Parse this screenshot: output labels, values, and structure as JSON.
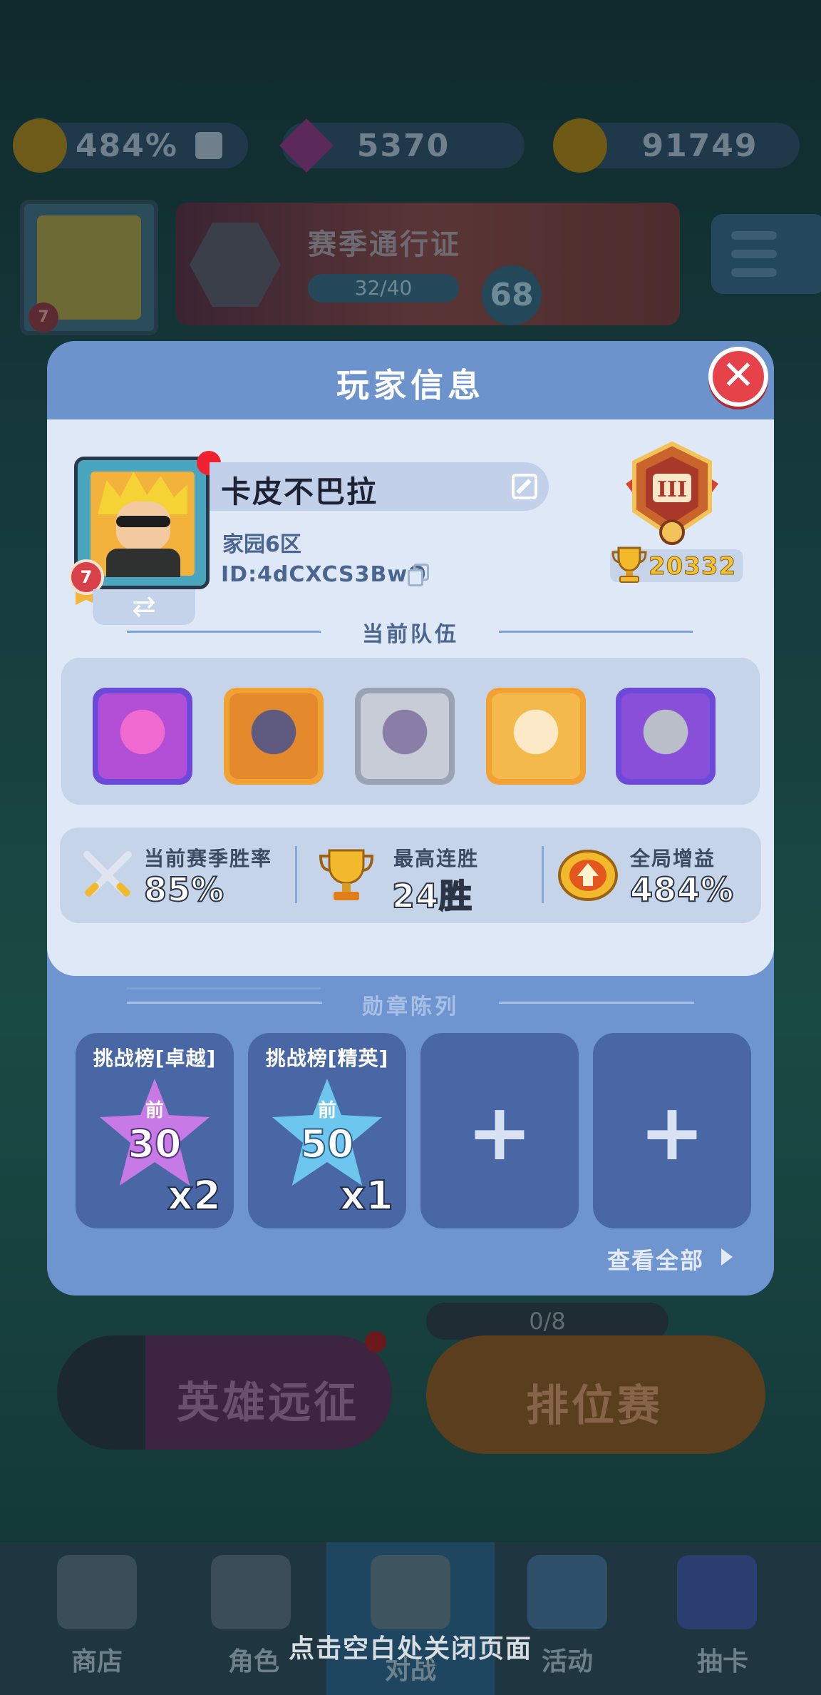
{
  "resources": {
    "global_bonus": "484%",
    "gems": "5370",
    "coins": "91749"
  },
  "background": {
    "player_level": "7",
    "season_pass": {
      "title": "赛季通行证",
      "progress": "32/40",
      "level": "68"
    },
    "hero_expedition_label": "英雄远征",
    "ranked_label": "排位赛",
    "ranked_progress": "0/8"
  },
  "bottom_nav": {
    "items": [
      {
        "label": "商店"
      },
      {
        "label": "角色"
      },
      {
        "label": "对战"
      },
      {
        "label": "活动"
      },
      {
        "label": "抽卡"
      }
    ]
  },
  "close_hint": "点击空白处关闭页面",
  "modal": {
    "title": "玩家信息",
    "player": {
      "name": "卡皮不巴拉",
      "region": "家园6区",
      "id": "ID:4dCXCS3BwQ",
      "level": "7",
      "rank_numeral": "III",
      "trophies": "20332"
    },
    "team_title": "当前队伍",
    "team": [
      {
        "icon": "pink-luchador-hero",
        "frame_color": "#7a4fe0"
      },
      {
        "icon": "dark-knight-hero",
        "frame_color": "#f2a232"
      },
      {
        "icon": "purple-ghost-hero",
        "frame_color": "#9aa3b4"
      },
      {
        "icon": "angel-hero",
        "frame_color": "#f2a232"
      },
      {
        "icon": "armored-knight-hero",
        "frame_color": "#7a4fe0"
      }
    ],
    "stats": [
      {
        "label": "当前赛季胜率",
        "value": "85%",
        "icon": "crossed-swords-icon"
      },
      {
        "label": "最高连胜",
        "value": "24胜",
        "icon": "trophy-icon"
      },
      {
        "label": "全局增益",
        "value": "484%",
        "icon": "bonus-crest-icon"
      }
    ],
    "medals_title": "勋章陈列",
    "medals": [
      {
        "name": "挑战榜[卓越]",
        "front": "前",
        "rank": "30",
        "count": "x2",
        "color": "#c77ae6"
      },
      {
        "name": "挑战榜[精英]",
        "front": "前",
        "rank": "50",
        "count": "x1",
        "color": "#6cc6ee"
      },
      {
        "name": "",
        "empty": true,
        "plus": "+"
      },
      {
        "name": "",
        "empty": true,
        "plus": "+"
      }
    ],
    "view_all": "查看全部"
  },
  "colors": {
    "modal_header": "#6d93cc",
    "modal_body": "#dfe8f6",
    "close_button": "#e54249",
    "trophy_text": "#f3c22f"
  }
}
